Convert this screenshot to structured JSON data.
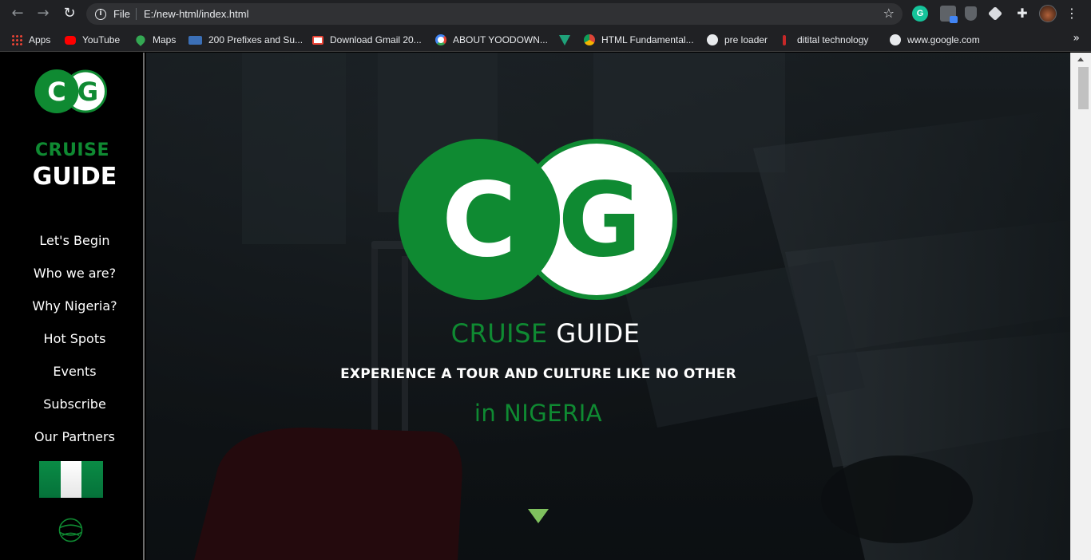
{
  "browser": {
    "nav": {
      "back": "←",
      "forward": "→",
      "reload": "↻"
    },
    "omnibox": {
      "scheme": "File",
      "url": "E:/new-html/index.html",
      "info_icon": "i"
    },
    "star": "☆",
    "extensions": {
      "grammarly": "G",
      "puzzle": "✚",
      "menu": "⋮"
    },
    "bookmarks": [
      {
        "label": "Apps",
        "icon": "apps-grid-icon",
        "color": "#ea4335"
      },
      {
        "label": "YouTube",
        "icon": "youtube-icon",
        "color": "#ff0000"
      },
      {
        "label": "Maps",
        "icon": "maps-pin-icon",
        "color": "#34a853"
      },
      {
        "label": "200 Prefixes and Su...",
        "icon": "dbt-icon",
        "color": "#3b6fb6"
      },
      {
        "label": "Download Gmail 20...",
        "icon": "gmail-icon",
        "color": "#ea4335"
      },
      {
        "label": "ABOUT YOODOWN...",
        "icon": "google-icon",
        "color": "#4285f4"
      },
      {
        "label": "",
        "icon": "vuetify-icon",
        "color": "#1fa27a"
      },
      {
        "label": "HTML Fundamental...",
        "icon": "chrome-icon",
        "color": "#db4437"
      },
      {
        "label": "pre loader",
        "icon": "globe-icon",
        "color": "#e8eaed"
      },
      {
        "label": "ditital technology",
        "icon": "bookmark-pin-icon",
        "color": "#c62828"
      },
      {
        "label": "www.google.com",
        "icon": "globe-icon",
        "color": "#e8eaed"
      }
    ],
    "bookmarks_overflow": "»"
  },
  "sidebar": {
    "logo_letters": {
      "c": "C",
      "g": "G"
    },
    "brand_top": "CRUISE",
    "brand_bottom": "GUIDE",
    "nav": [
      {
        "label": "Let's Begin"
      },
      {
        "label": "Who we are?"
      },
      {
        "label": "Why Nigeria?"
      },
      {
        "label": "Hot Spots"
      },
      {
        "label": "Events"
      },
      {
        "label": "Subscribe"
      },
      {
        "label": "Our Partners"
      }
    ]
  },
  "hero": {
    "logo_letters": {
      "c": "C",
      "g": "G"
    },
    "title_green": "CRUISE",
    "title_white": "GUIDE",
    "tagline": "EXPERIENCE A TOUR AND CULTURE LIKE NO OTHER",
    "subtitle": "in NIGERIA"
  },
  "colors": {
    "brand_green": "#0f8a32",
    "arrow_green": "#7fc15e",
    "sidebar_bg": "#000000",
    "chrome_bg": "#202124"
  }
}
